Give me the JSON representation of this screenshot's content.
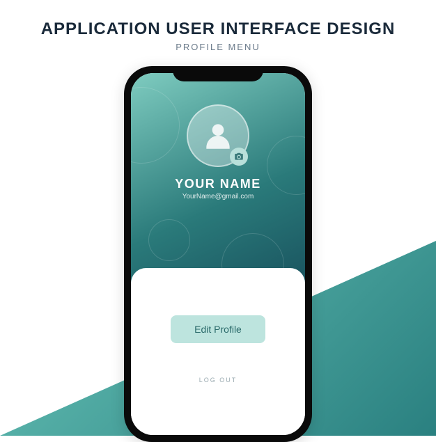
{
  "page": {
    "title": "APPLICATION USER INTERFACE DESIGN",
    "subtitle": "PROFILE MENU"
  },
  "profile": {
    "name": "YOUR NAME",
    "email": "YourName@gmail.com"
  },
  "actions": {
    "edit_label": "Edit Profile",
    "logout_label": "LOG OUT"
  },
  "colors": {
    "accent": "#bde4de",
    "gradient_start": "#7fccc0",
    "gradient_end": "#1a5560"
  }
}
